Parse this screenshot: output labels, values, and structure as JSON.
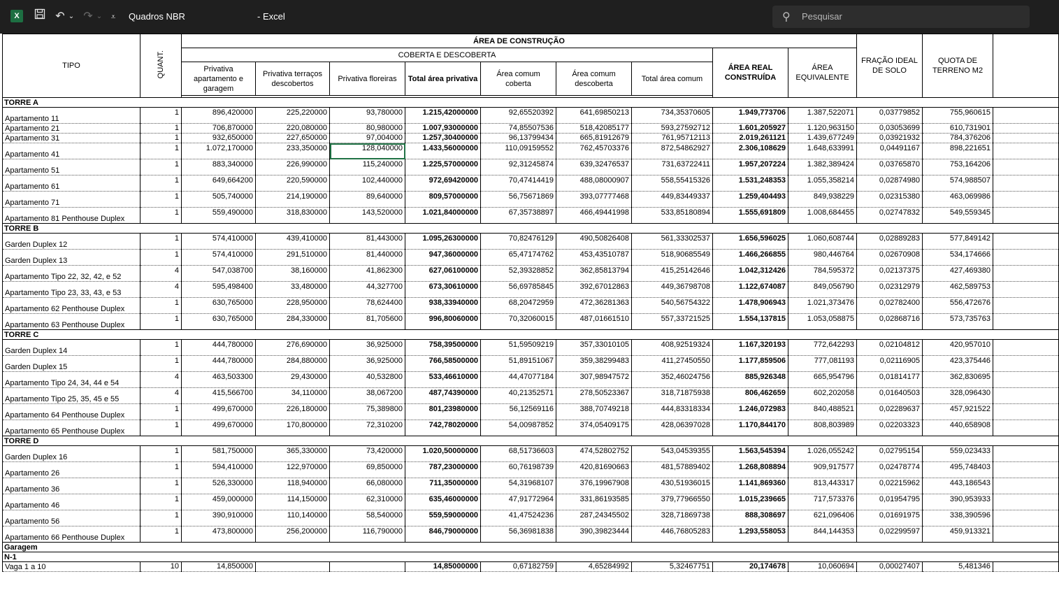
{
  "titlebar": {
    "logo": "X",
    "doc_title": "Quadros NBR",
    "app_title": "- Excel",
    "search_placeholder": "Pesquisar",
    "icons": [
      "excel-logo-icon",
      "save-icon",
      "undo-icon",
      "redo-icon",
      "customize-toolbar-icon",
      "search-icon"
    ]
  },
  "sheet": {
    "headers": {
      "tipo": "TIPO",
      "quant": "QUANT.",
      "area_construcao": "ÁREA DE CONSTRUÇÃO",
      "coberta_descoberta": "COBERTA E DESCOBERTA",
      "priv_ap": "Privativa apartamento e garagem",
      "priv_terr": "Privativa terraços descobertos",
      "priv_flor": "Privativa floreiras",
      "total_priv": "Total área privativa",
      "comum_cob": "Área comum coberta",
      "comum_desc": "Área comum descoberta",
      "total_comum": "Total área comum",
      "area_real": "ÁREA REAL CONSTRUÍDA",
      "area_equiv": "ÁREA EQUIVALENTE",
      "fracao": "FRAÇÃO IDEAL DE SOLO",
      "quota": "QUOTA DE TERRENO M2"
    },
    "rows": [
      {
        "section": "TORRE A"
      },
      {
        "tipo": "Apartamento 11",
        "q": "1",
        "c": [
          "896,420000",
          "225,220000",
          "93,780000",
          "1.215,42000000",
          "92,65520392",
          "641,69850213",
          "734,35370605",
          "1.949,773706",
          "1.387,522071",
          "0,03779852",
          "755,960615"
        ]
      },
      {
        "tipo": "Apartamento 21",
        "q": "1",
        "thin": true,
        "c": [
          "706,870000",
          "220,080000",
          "80,980000",
          "1.007,93000000",
          "74,85507536",
          "518,42085177",
          "593,27592712",
          "1.601,205927",
          "1.120,963150",
          "0,03053699",
          "610,731901"
        ]
      },
      {
        "tipo": "Apartamento 31",
        "q": "1",
        "thin": true,
        "c": [
          "932,650000",
          "227,650000",
          "97,004000",
          "1.257,30400000",
          "96,13799434",
          "665,81912679",
          "761,95712113",
          "2.019,261121",
          "1.439,677249",
          "0,03921932",
          "784,376206"
        ]
      },
      {
        "tipo": "Apartamento 41",
        "q": "1",
        "sel": true,
        "c": [
          "1.072,170000",
          "233,350000",
          "128,040000",
          "1.433,56000000",
          "110,09159552",
          "762,45703376",
          "872,54862927",
          "2.306,108629",
          "1.648,633991",
          "0,04491167",
          "898,221651"
        ]
      },
      {
        "tipo": " Apartamento 51",
        "q": "1",
        "c": [
          "883,340000",
          "226,990000",
          "115,240000",
          "1.225,57000000",
          "92,31245874",
          "639,32476537",
          "731,63722411",
          "1.957,207224",
          "1.382,389424",
          "0,03765870",
          "753,164206"
        ]
      },
      {
        "tipo": "Apartamento 61",
        "q": "1",
        "c": [
          "649,664200",
          "220,590000",
          "102,440000",
          "972,69420000",
          "70,47414419",
          "488,08000907",
          "558,55415326",
          "1.531,248353",
          "1.055,358214",
          "0,02874980",
          "574,988507"
        ]
      },
      {
        "tipo": "Apartamento 71",
        "q": "1",
        "c": [
          "505,740000",
          "214,190000",
          "89,640000",
          "809,57000000",
          "56,75671869",
          "393,07777468",
          "449,83449337",
          "1.259,404493",
          "849,938229",
          "0,02315380",
          "463,069986"
        ]
      },
      {
        "tipo": "Apartamento 81 Penthouse Duplex",
        "q": "1",
        "c": [
          "559,490000",
          "318,830000",
          "143,520000",
          "1.021,84000000",
          "67,35738897",
          "466,49441998",
          "533,85180894",
          "1.555,691809",
          "1.008,684455",
          "0,02747832",
          "549,559345"
        ]
      },
      {
        "section": "TORRE B"
      },
      {
        "tipo": "Garden Duplex 12",
        "q": "1",
        "c": [
          "574,410000",
          "439,410000",
          "81,443000",
          "1.095,26300000",
          "70,82476129",
          "490,50826408",
          "561,33302537",
          "1.656,596025",
          "1.060,608744",
          "0,02889283",
          "577,849142"
        ]
      },
      {
        "tipo": "Garden Duplex 13",
        "q": "1",
        "c": [
          "574,410000",
          "291,510000",
          "81,440000",
          "947,36000000",
          "65,47174762",
          "453,43510787",
          "518,90685549",
          "1.466,266855",
          "980,446764",
          "0,02670908",
          "534,174666"
        ]
      },
      {
        "tipo": "Apartamento Tipo 22, 32, 42, e 52",
        "q": "4",
        "c": [
          "547,038700",
          "38,160000",
          "41,862300",
          "627,06100000",
          "52,39328852",
          "362,85813794",
          "415,25142646",
          "1.042,312426",
          "784,595372",
          "0,02137375",
          "427,469380"
        ]
      },
      {
        "tipo": "Apartamento Tipo 23, 33, 43, e 53",
        "q": "4",
        "c": [
          "595,498400",
          "33,480000",
          "44,327700",
          "673,30610000",
          "56,69785845",
          "392,67012863",
          "449,36798708",
          "1.122,674087",
          "849,056790",
          "0,02312979",
          "462,589753"
        ]
      },
      {
        "tipo": "Apartamento 62 Penthouse Duplex",
        "q": "1",
        "c": [
          "630,765000",
          "228,950000",
          "78,624400",
          "938,33940000",
          "68,20472959",
          "472,36281363",
          "540,56754322",
          "1.478,906943",
          "1.021,373476",
          "0,02782400",
          "556,472676"
        ]
      },
      {
        "tipo": "Apartamento 63 Penthouse Duplex",
        "q": "1",
        "c": [
          "630,765000",
          "284,330000",
          "81,705600",
          "996,80060000",
          "70,32060015",
          "487,01661510",
          "557,33721525",
          "1.554,137815",
          "1.053,058875",
          "0,02868716",
          "573,735763"
        ]
      },
      {
        "section": "TORRE C"
      },
      {
        "tipo": "Garden Duplex 14",
        "q": "1",
        "c": [
          "444,780000",
          "276,690000",
          "36,925000",
          "758,39500000",
          "51,59509219",
          "357,33010105",
          "408,92519324",
          "1.167,320193",
          "772,642293",
          "0,02104812",
          "420,957010"
        ]
      },
      {
        "tipo": "Garden Duplex 15",
        "q": "1",
        "c": [
          "444,780000",
          "284,880000",
          "36,925000",
          "766,58500000",
          "51,89151067",
          "359,38299483",
          "411,27450550",
          "1.177,859506",
          "777,081193",
          "0,02116905",
          "423,375446"
        ]
      },
      {
        "tipo": "Apartamento Tipo 24, 34, 44 e 54",
        "q": "4",
        "c": [
          "463,503300",
          "29,430000",
          "40,532800",
          "533,46610000",
          "44,47077184",
          "307,98947572",
          "352,46024756",
          "885,926348",
          "665,954796",
          "0,01814177",
          "362,830695"
        ]
      },
      {
        "tipo": "Apartamento Tipo 25, 35, 45 e 55",
        "q": "4",
        "c": [
          "415,566700",
          "34,110000",
          "38,067200",
          "487,74390000",
          "40,21352571",
          "278,50523367",
          "318,71875938",
          "806,462659",
          "602,202058",
          "0,01640503",
          "328,096430"
        ]
      },
      {
        "tipo": "Apartamento 64 Penthouse Duplex",
        "q": "1",
        "c": [
          "499,670000",
          "226,180000",
          "75,389800",
          "801,23980000",
          "56,12569116",
          "388,70749218",
          "444,83318334",
          "1.246,072983",
          "840,488521",
          "0,02289637",
          "457,921522"
        ]
      },
      {
        "tipo": "Apartamento 65 Penthouse Duplex",
        "q": "1",
        "c": [
          "499,670000",
          "170,800000",
          "72,310200",
          "742,78020000",
          "54,00987852",
          "374,05409175",
          "428,06397028",
          "1.170,844170",
          "808,803989",
          "0,02203323",
          "440,658908"
        ]
      },
      {
        "section": "TORRE D"
      },
      {
        "tipo": "Garden Duplex 16",
        "q": "1",
        "c": [
          "581,750000",
          "365,330000",
          "73,420000",
          "1.020,50000000",
          "68,51736603",
          "474,52802752",
          "543,04539355",
          "1.563,545394",
          "1.026,055242",
          "0,02795154",
          "559,023433"
        ]
      },
      {
        "tipo": "Apartamento 26",
        "q": "1",
        "c": [
          "594,410000",
          "122,970000",
          "69,850000",
          "787,23000000",
          "60,76198739",
          "420,81690663",
          "481,57889402",
          "1.268,808894",
          "909,917577",
          "0,02478774",
          "495,748403"
        ]
      },
      {
        "tipo": "Apartamento 36",
        "q": "1",
        "c": [
          "526,330000",
          "118,940000",
          "66,080000",
          "711,35000000",
          "54,31968107",
          "376,19967908",
          "430,51936015",
          "1.141,869360",
          "813,443317",
          "0,02215962",
          "443,186543"
        ]
      },
      {
        "tipo": "Apartamento 46",
        "q": "1",
        "c": [
          "459,000000",
          "114,150000",
          "62,310000",
          "635,46000000",
          "47,91772964",
          "331,86193585",
          "379,77966550",
          "1.015,239665",
          "717,573376",
          "0,01954795",
          "390,953933"
        ]
      },
      {
        "tipo": "Apartamento 56",
        "q": "1",
        "c": [
          "390,910000",
          "110,140000",
          "58,540000",
          "559,59000000",
          "41,47524236",
          "287,24345502",
          "328,71869738",
          "888,308697",
          "621,096406",
          "0,01691975",
          "338,390596"
        ]
      },
      {
        "tipo": "Apartamento 66 Penthouse Duplex",
        "q": "1",
        "c": [
          "473,800000",
          "256,200000",
          "116,790000",
          "846,79000000",
          "56,36981838",
          "390,39823444",
          "446,76805283",
          "1.293,558053",
          "844,144353",
          "0,02299597",
          "459,913321"
        ]
      },
      {
        "section": "Garagem"
      },
      {
        "section": "N-1"
      },
      {
        "tipo": "Vaga 1 a 10",
        "q": "10",
        "thin": true,
        "c": [
          "14,850000",
          "",
          "",
          "14,85000000",
          "0,67182759",
          "4,65284992",
          "5,32467751",
          "20,174678",
          "10,060694",
          "0,00027407",
          "5,481346"
        ]
      }
    ]
  }
}
